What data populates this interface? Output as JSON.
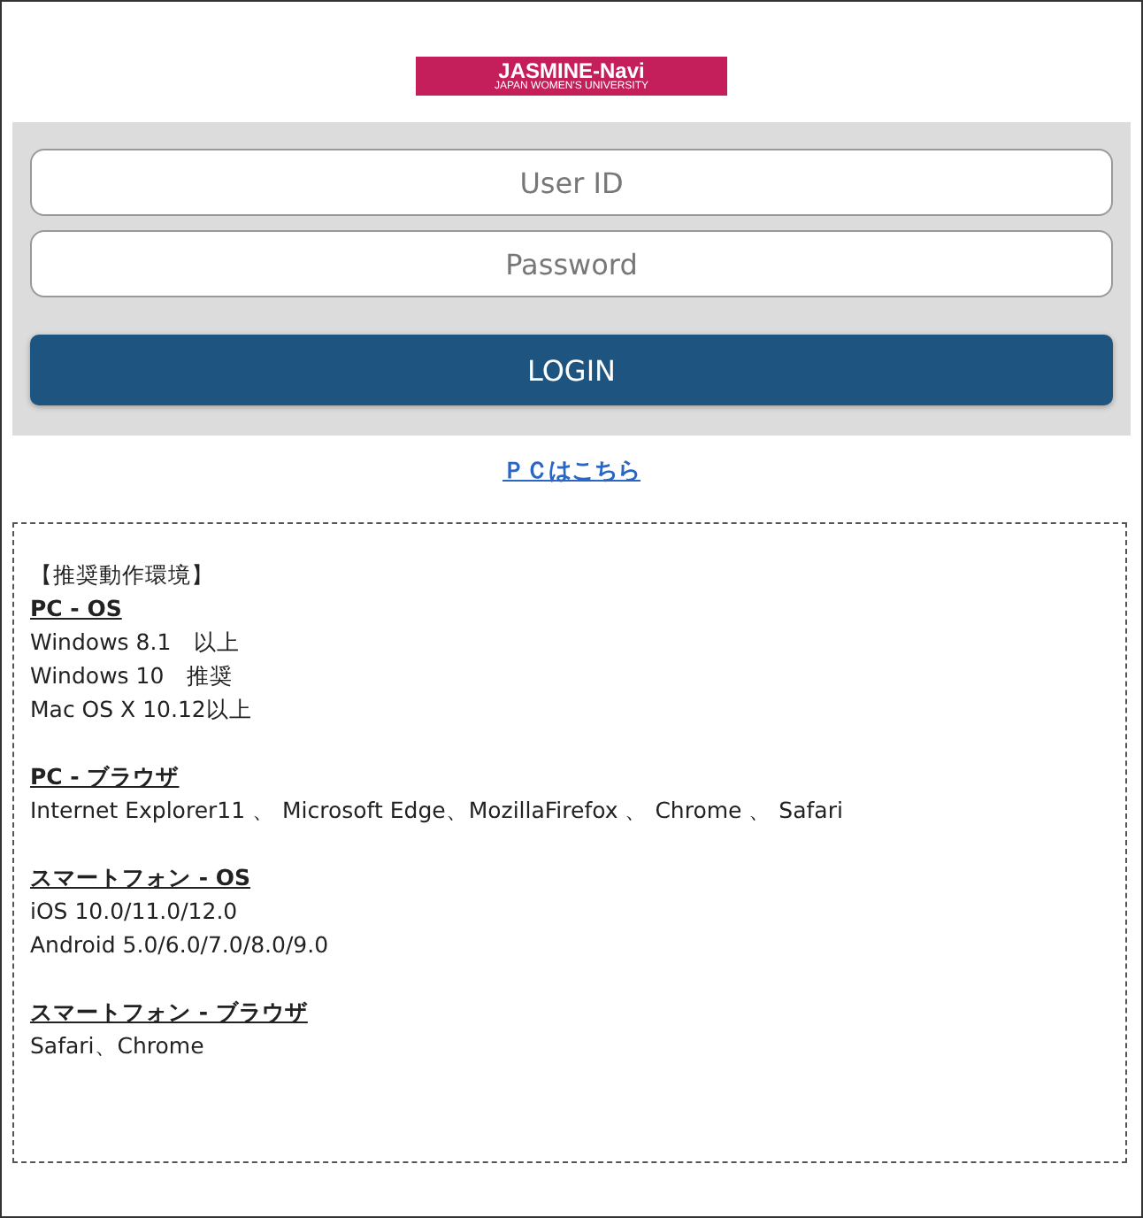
{
  "logo": {
    "title": "JASMINE-Navi",
    "subtitle": "JAPAN WOMEN'S UNIVERSITY"
  },
  "login_form": {
    "user_id": {
      "placeholder": "User ID"
    },
    "password": {
      "placeholder": "Password"
    },
    "button": "LOGIN"
  },
  "pc_link": "ＰＣはこちら",
  "environment": {
    "title": "【推奨動作環境】",
    "sections": [
      {
        "heading": "PC - OS",
        "lines": [
          "Windows 8.1　以上",
          "Windows 10　推奨",
          "Mac OS X 10.12以上"
        ]
      },
      {
        "heading": "PC - ブラウザ",
        "lines": [
          "Internet Explorer11 、 Microsoft Edge、MozillaFirefox 、 Chrome 、 Safari"
        ]
      },
      {
        "heading": "スマートフォン - OS",
        "lines": [
          "iOS 10.0/11.0/12.0",
          "Android 5.0/6.0/7.0/8.0/9.0"
        ]
      },
      {
        "heading": "スマートフォン - ブラウザ",
        "lines": [
          "Safari、Chrome"
        ]
      }
    ]
  }
}
